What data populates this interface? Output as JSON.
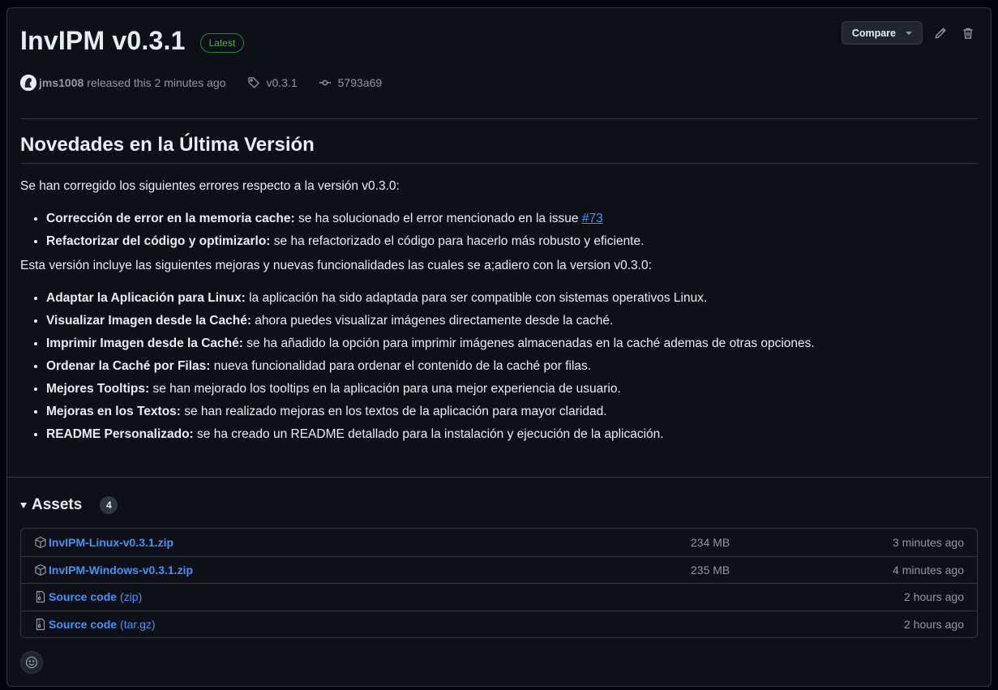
{
  "release": {
    "title": "InvIPM v0.3.1",
    "badge": "Latest",
    "author": "jms1008",
    "released_text": "released this 2 minutes ago",
    "tag": "v0.3.1",
    "commit": "5793a69"
  },
  "actions": {
    "compare_label": "Compare"
  },
  "notes": {
    "heading": "Novedades en la Última Versión",
    "intro_fixes": "Se han corregido los siguientes errores respecto a la versión v0.3.0:",
    "fixes": [
      {
        "bold": "Corrección de error en la memoria cache:",
        "text": " se ha solucionado el error mencionado en la issue ",
        "link": "#73"
      },
      {
        "bold": "Refactorizar del código y optimizarlo:",
        "text": " se ha refactorizado el código para hacerlo más robusto y eficiente."
      }
    ],
    "intro_features": "Esta versión incluye las siguientes mejoras y nuevas funcionalidades las cuales se a;adiero con la version v0.3.0:",
    "features": [
      {
        "bold": "Adaptar la Aplicación para Linux:",
        "text": " la aplicación ha sido adaptada para ser compatible con sistemas operativos Linux."
      },
      {
        "bold": "Visualizar Imagen desde la Caché:",
        "text": " ahora puedes visualizar imágenes directamente desde la caché."
      },
      {
        "bold": "Imprimir Imagen desde la Caché:",
        "text": " se ha añadido la opción para imprimir imágenes almacenadas en la caché ademas de otras opciones."
      },
      {
        "bold": "Ordenar la Caché por Filas:",
        "text": " nueva funcionalidad para ordenar el contenido de la caché por filas."
      },
      {
        "bold": "Mejores Tooltips:",
        "text": " se han mejorado los tooltips en la aplicación para una mejor experiencia de usuario."
      },
      {
        "bold": "Mejoras en los Textos:",
        "text": " se han realizado mejoras en los textos de la aplicación para mayor claridad."
      },
      {
        "bold": "README Personalizado:",
        "text": " se ha creado un README detallado para la instalación y ejecución de la aplicación."
      }
    ]
  },
  "assets": {
    "title": "Assets",
    "count": "4",
    "items": [
      {
        "name": "InvIPM-Linux-v0.3.1.zip",
        "ext": "",
        "size": "234 MB",
        "time": "3 minutes ago",
        "icon": "package-icon"
      },
      {
        "name": "InvIPM-Windows-v0.3.1.zip",
        "ext": "",
        "size": "235 MB",
        "time": "4 minutes ago",
        "icon": "package-icon"
      },
      {
        "name": "Source code",
        "ext": "(zip)",
        "size": "",
        "time": "2 hours ago",
        "icon": "file-zip-icon"
      },
      {
        "name": "Source code",
        "ext": "(tar.gz)",
        "size": "",
        "time": "2 hours ago",
        "icon": "file-zip-icon"
      }
    ]
  },
  "colors": {
    "background": "#0d1117",
    "border": "#30363d",
    "link": "#4493f8",
    "latest_green": "#3fb950",
    "muted": "#9198a1"
  }
}
